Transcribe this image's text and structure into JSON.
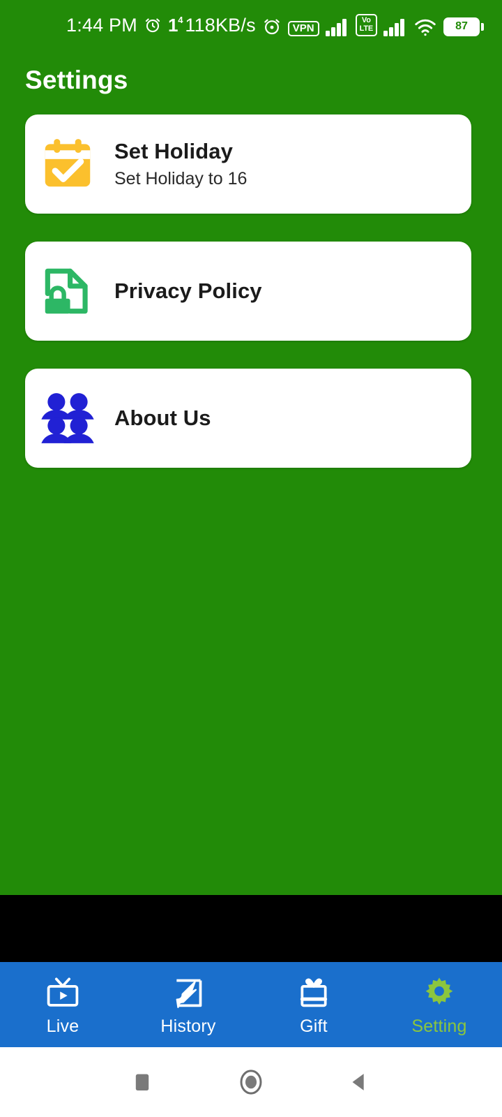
{
  "status_bar": {
    "time": "1:44 PM",
    "alarm_icon": "alarm-clock-icon",
    "notification_count": "1",
    "notification_superscript": "4",
    "network_speed": "118KB/s",
    "clock_icon": "clock-icon",
    "vpn_label": "VPN",
    "volte_top": "Vo",
    "volte_bottom": "LTE",
    "signal_icon": "signal-bars-icon",
    "signal2_icon": "signal-bars-icon",
    "wifi_icon": "wifi-icon",
    "battery_level": "87"
  },
  "header": {
    "title": "Settings"
  },
  "settings": {
    "items": [
      {
        "title": "Set Holiday",
        "subtitle": "Set Holiday to 16",
        "icon": "calendar-check-icon",
        "icon_color": "#FBC02D"
      },
      {
        "title": "Privacy Policy",
        "subtitle": "",
        "icon": "document-lock-icon",
        "icon_color": "#2DB765"
      },
      {
        "title": "About Us",
        "subtitle": "",
        "icon": "people-group-icon",
        "icon_color": "#2121D4"
      }
    ]
  },
  "bottom_nav": {
    "items": [
      {
        "label": "Live",
        "icon": "tv-play-icon",
        "active": false
      },
      {
        "label": "History",
        "icon": "history-icon",
        "active": false
      },
      {
        "label": "Gift",
        "icon": "gift-icon",
        "active": false
      },
      {
        "label": "Setting",
        "icon": "gear-icon",
        "active": true
      }
    ],
    "background_color": "#1A6FCC",
    "active_color": "#8BC63E",
    "inactive_color": "#FFFFFF"
  },
  "system_nav": {
    "recents": "recents-square-icon",
    "home": "home-circle-icon",
    "back": "back-triangle-icon"
  },
  "theme": {
    "background_green": "#228B08",
    "card_white": "#FFFFFF",
    "ad_strip_black": "#000000"
  }
}
